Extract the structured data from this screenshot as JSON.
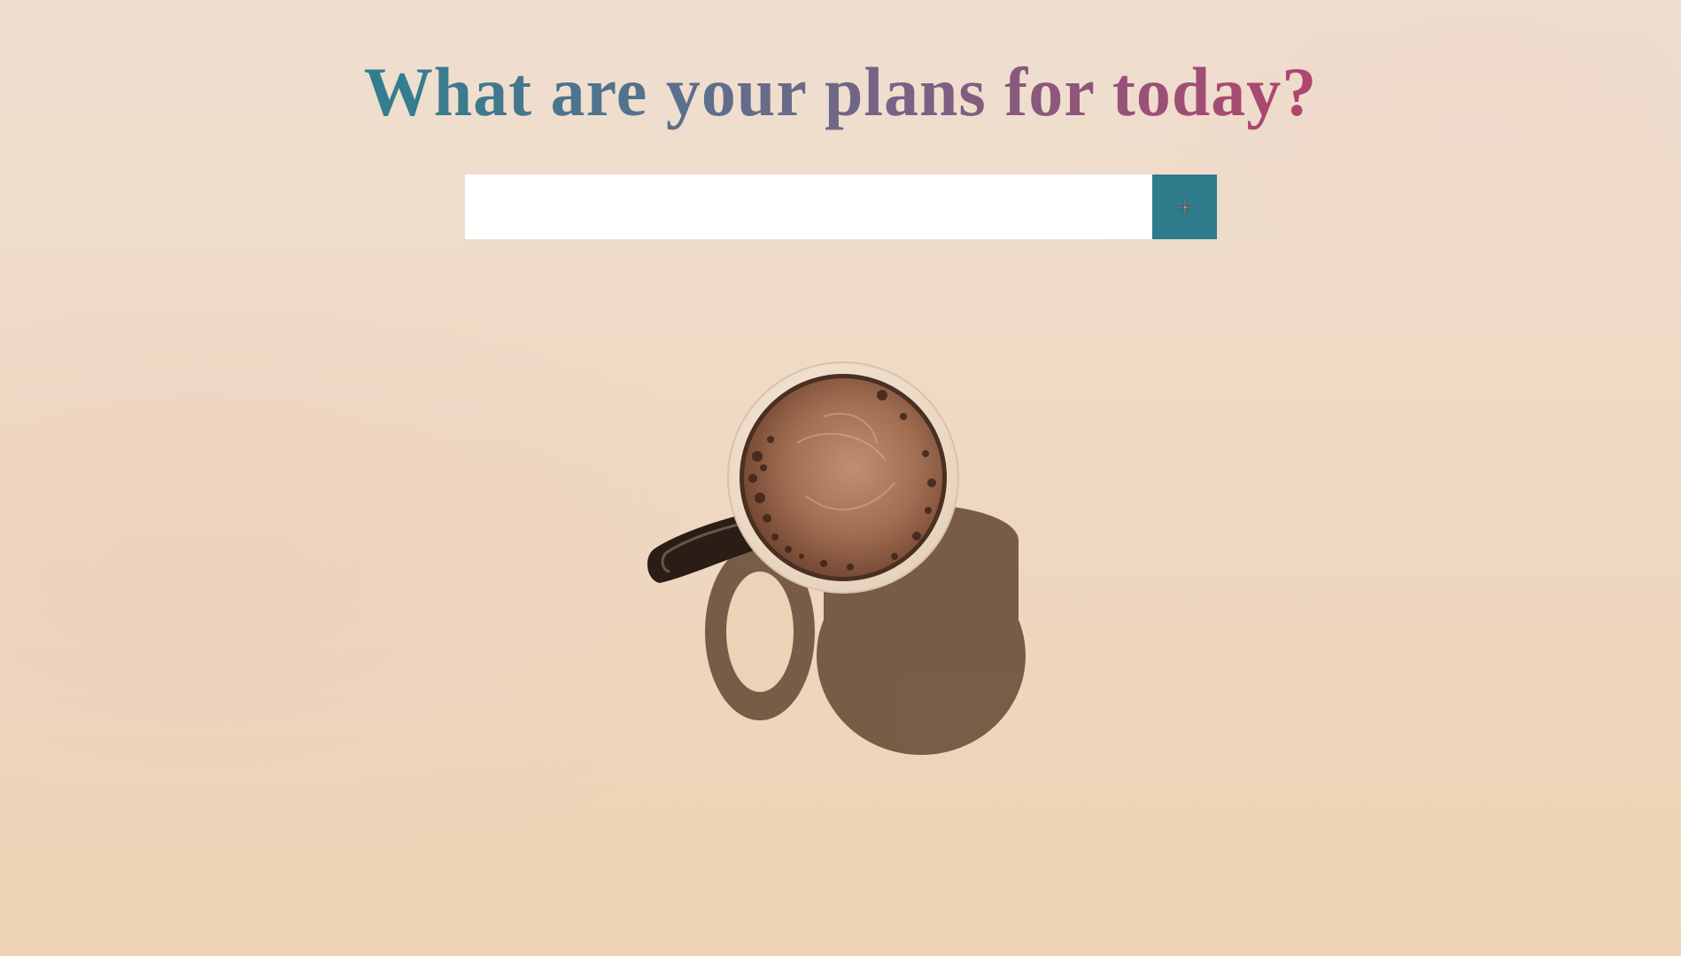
{
  "header": {
    "title": "What are your plans for today?"
  },
  "todo_form": {
    "input_value": "",
    "input_placeholder": "",
    "add_button_icon": "plus-icon"
  },
  "background": {
    "image": "coffee-cup-on-beige-surface",
    "accent_color": "#2e7c8b",
    "title_gradient": [
      "#2f7f90",
      "#6a6a8a",
      "#b0456e"
    ]
  }
}
